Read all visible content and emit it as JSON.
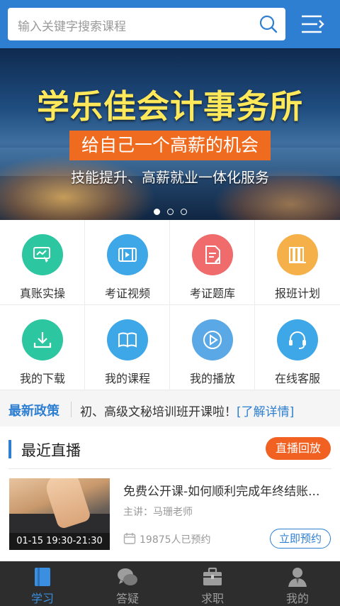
{
  "search": {
    "placeholder": "输入关键字搜索课程"
  },
  "banner": {
    "title": "学乐佳会计事务所",
    "tagline": "给自己一个高薪的机会",
    "subtitle": "技能提升、高薪就业一体化服务",
    "slides_total": 3,
    "active_slide": 1
  },
  "grid": {
    "items": [
      {
        "label": "真账实操",
        "icon": "practice-icon",
        "color": "#2cc7a0"
      },
      {
        "label": "考证视频",
        "icon": "video-icon",
        "color": "#3ea7e8"
      },
      {
        "label": "考证题库",
        "icon": "question-bank-icon",
        "color": "#f06b6b"
      },
      {
        "label": "报班计划",
        "icon": "books-icon",
        "color": "#f6b04a"
      },
      {
        "label": "我的下载",
        "icon": "download-icon",
        "color": "#2cc7a0"
      },
      {
        "label": "我的课程",
        "icon": "book-open-icon",
        "color": "#3ea7e8"
      },
      {
        "label": "我的播放",
        "icon": "play-icon",
        "color": "#5aa9e6"
      },
      {
        "label": "在线客服",
        "icon": "headset-icon",
        "color": "#3ea7e8"
      }
    ]
  },
  "news": {
    "tag": "最新政策",
    "text": "初、高级文秘培训班开课啦！",
    "link": "[了解详情]"
  },
  "live": {
    "title": "最近直播",
    "replay_label": "直播回放",
    "course": {
      "title": "免费公开课-如何顺利完成年终结账...",
      "teacher": "主讲：马珊老师",
      "time": "01-15  19:30-21:30",
      "count": "19875人已预约",
      "book_label": "立即预约"
    }
  },
  "tabbar": {
    "items": [
      {
        "label": "学习",
        "icon": "study-book-icon",
        "active": true
      },
      {
        "label": "答疑",
        "icon": "chat-bubbles-icon",
        "active": false
      },
      {
        "label": "求职",
        "icon": "briefcase-icon",
        "active": false
      },
      {
        "label": "我的",
        "icon": "person-icon",
        "active": false
      }
    ]
  },
  "colors": {
    "primary": "#2e7fd2",
    "accent": "#f16122",
    "banner_title": "#ffe95a"
  }
}
